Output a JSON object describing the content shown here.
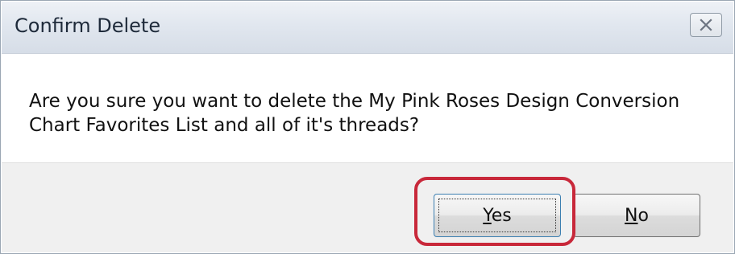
{
  "dialog": {
    "title": "Confirm Delete",
    "message": "Are you sure you want to delete the My Pink Roses Design Conversion Chart Favorites List and all of it's threads?",
    "close_icon": "close-icon"
  },
  "buttons": {
    "yes": {
      "mnemonic": "Y",
      "rest": "es",
      "label": "Yes"
    },
    "no": {
      "mnemonic": "N",
      "rest": "o",
      "label": "No"
    }
  },
  "colors": {
    "highlight": "#c8283a",
    "title_bar": "#e1e7ef",
    "button_bar": "#f0f0f0"
  }
}
